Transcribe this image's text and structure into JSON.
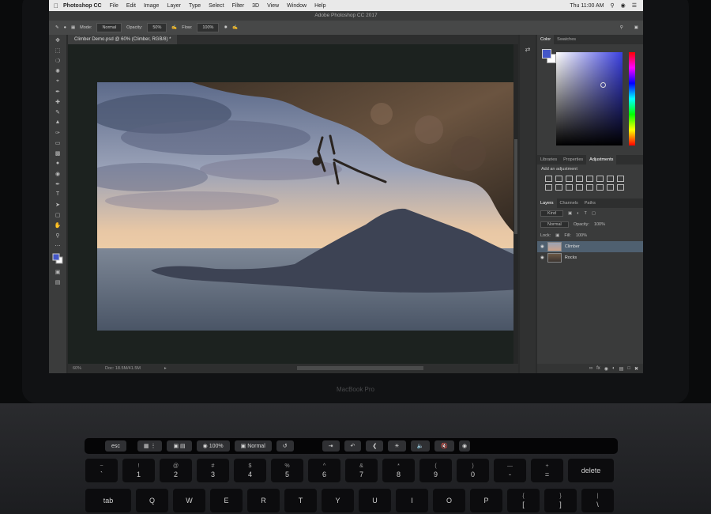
{
  "menubar": {
    "app_name": "Photoshop CC",
    "items": [
      "File",
      "Edit",
      "Image",
      "Layer",
      "Type",
      "Select",
      "Filter",
      "3D",
      "View",
      "Window",
      "Help"
    ],
    "clock": "Thu 11:00 AM"
  },
  "window": {
    "title": "Adobe Photoshop CC 2017"
  },
  "options_bar": {
    "mode_label": "Mode:",
    "mode_value": "Normal",
    "opacity_label": "Opacity:",
    "opacity_value": "50%",
    "flow_label": "Flow:",
    "flow_value": "100%"
  },
  "document": {
    "tab_label": "Climber Demo.psd @ 60% (Climber, RGB/8) *"
  },
  "status": {
    "zoom": "60%",
    "doc_info": "Doc: 18.5M/41.5M"
  },
  "panels": {
    "top_tabs": [
      "Color",
      "Swatches"
    ],
    "mid_tabs": [
      "Libraries",
      "Properties",
      "Adjustments"
    ],
    "adjustments_title": "Add an adjustment",
    "layer_tabs": [
      "Layers",
      "Channels",
      "Paths"
    ],
    "layer_filter": "Kind",
    "blend_mode": "Normal",
    "opacity_label": "Opacity:",
    "opacity_value": "100%",
    "lock_label": "Lock:",
    "fill_label": "Fill:",
    "fill_value": "100%",
    "layers": [
      {
        "name": "Climber",
        "selected": true
      },
      {
        "name": "Rocks",
        "selected": false
      }
    ],
    "fg_color": "#4457c8"
  },
  "laptop": {
    "label": "MacBook Pro"
  },
  "touchbar": {
    "esc": "esc",
    "zoom_value": "100%",
    "blend_value": "Normal"
  },
  "keyboard": {
    "row1": [
      {
        "top": "~",
        "main": "`"
      },
      {
        "top": "!",
        "main": "1"
      },
      {
        "top": "@",
        "main": "2"
      },
      {
        "top": "#",
        "main": "3"
      },
      {
        "top": "$",
        "main": "4"
      },
      {
        "top": "%",
        "main": "5"
      },
      {
        "top": "^",
        "main": "6"
      },
      {
        "top": "&",
        "main": "7"
      },
      {
        "top": "*",
        "main": "8"
      },
      {
        "top": "(",
        "main": "9"
      },
      {
        "top": ")",
        "main": "0"
      },
      {
        "top": "—",
        "main": "-"
      },
      {
        "top": "+",
        "main": "="
      },
      {
        "top": "",
        "main": "delete"
      }
    ],
    "row2": [
      {
        "top": "",
        "main": "tab"
      },
      {
        "top": "",
        "main": "Q"
      },
      {
        "top": "",
        "main": "W"
      },
      {
        "top": "",
        "main": "E"
      },
      {
        "top": "",
        "main": "R"
      },
      {
        "top": "",
        "main": "T"
      },
      {
        "top": "",
        "main": "Y"
      },
      {
        "top": "",
        "main": "U"
      },
      {
        "top": "",
        "main": "I"
      },
      {
        "top": "",
        "main": "O"
      },
      {
        "top": "",
        "main": "P"
      },
      {
        "top": "{",
        "main": "["
      },
      {
        "top": "}",
        "main": "]"
      },
      {
        "top": "|",
        "main": "\\"
      }
    ]
  }
}
